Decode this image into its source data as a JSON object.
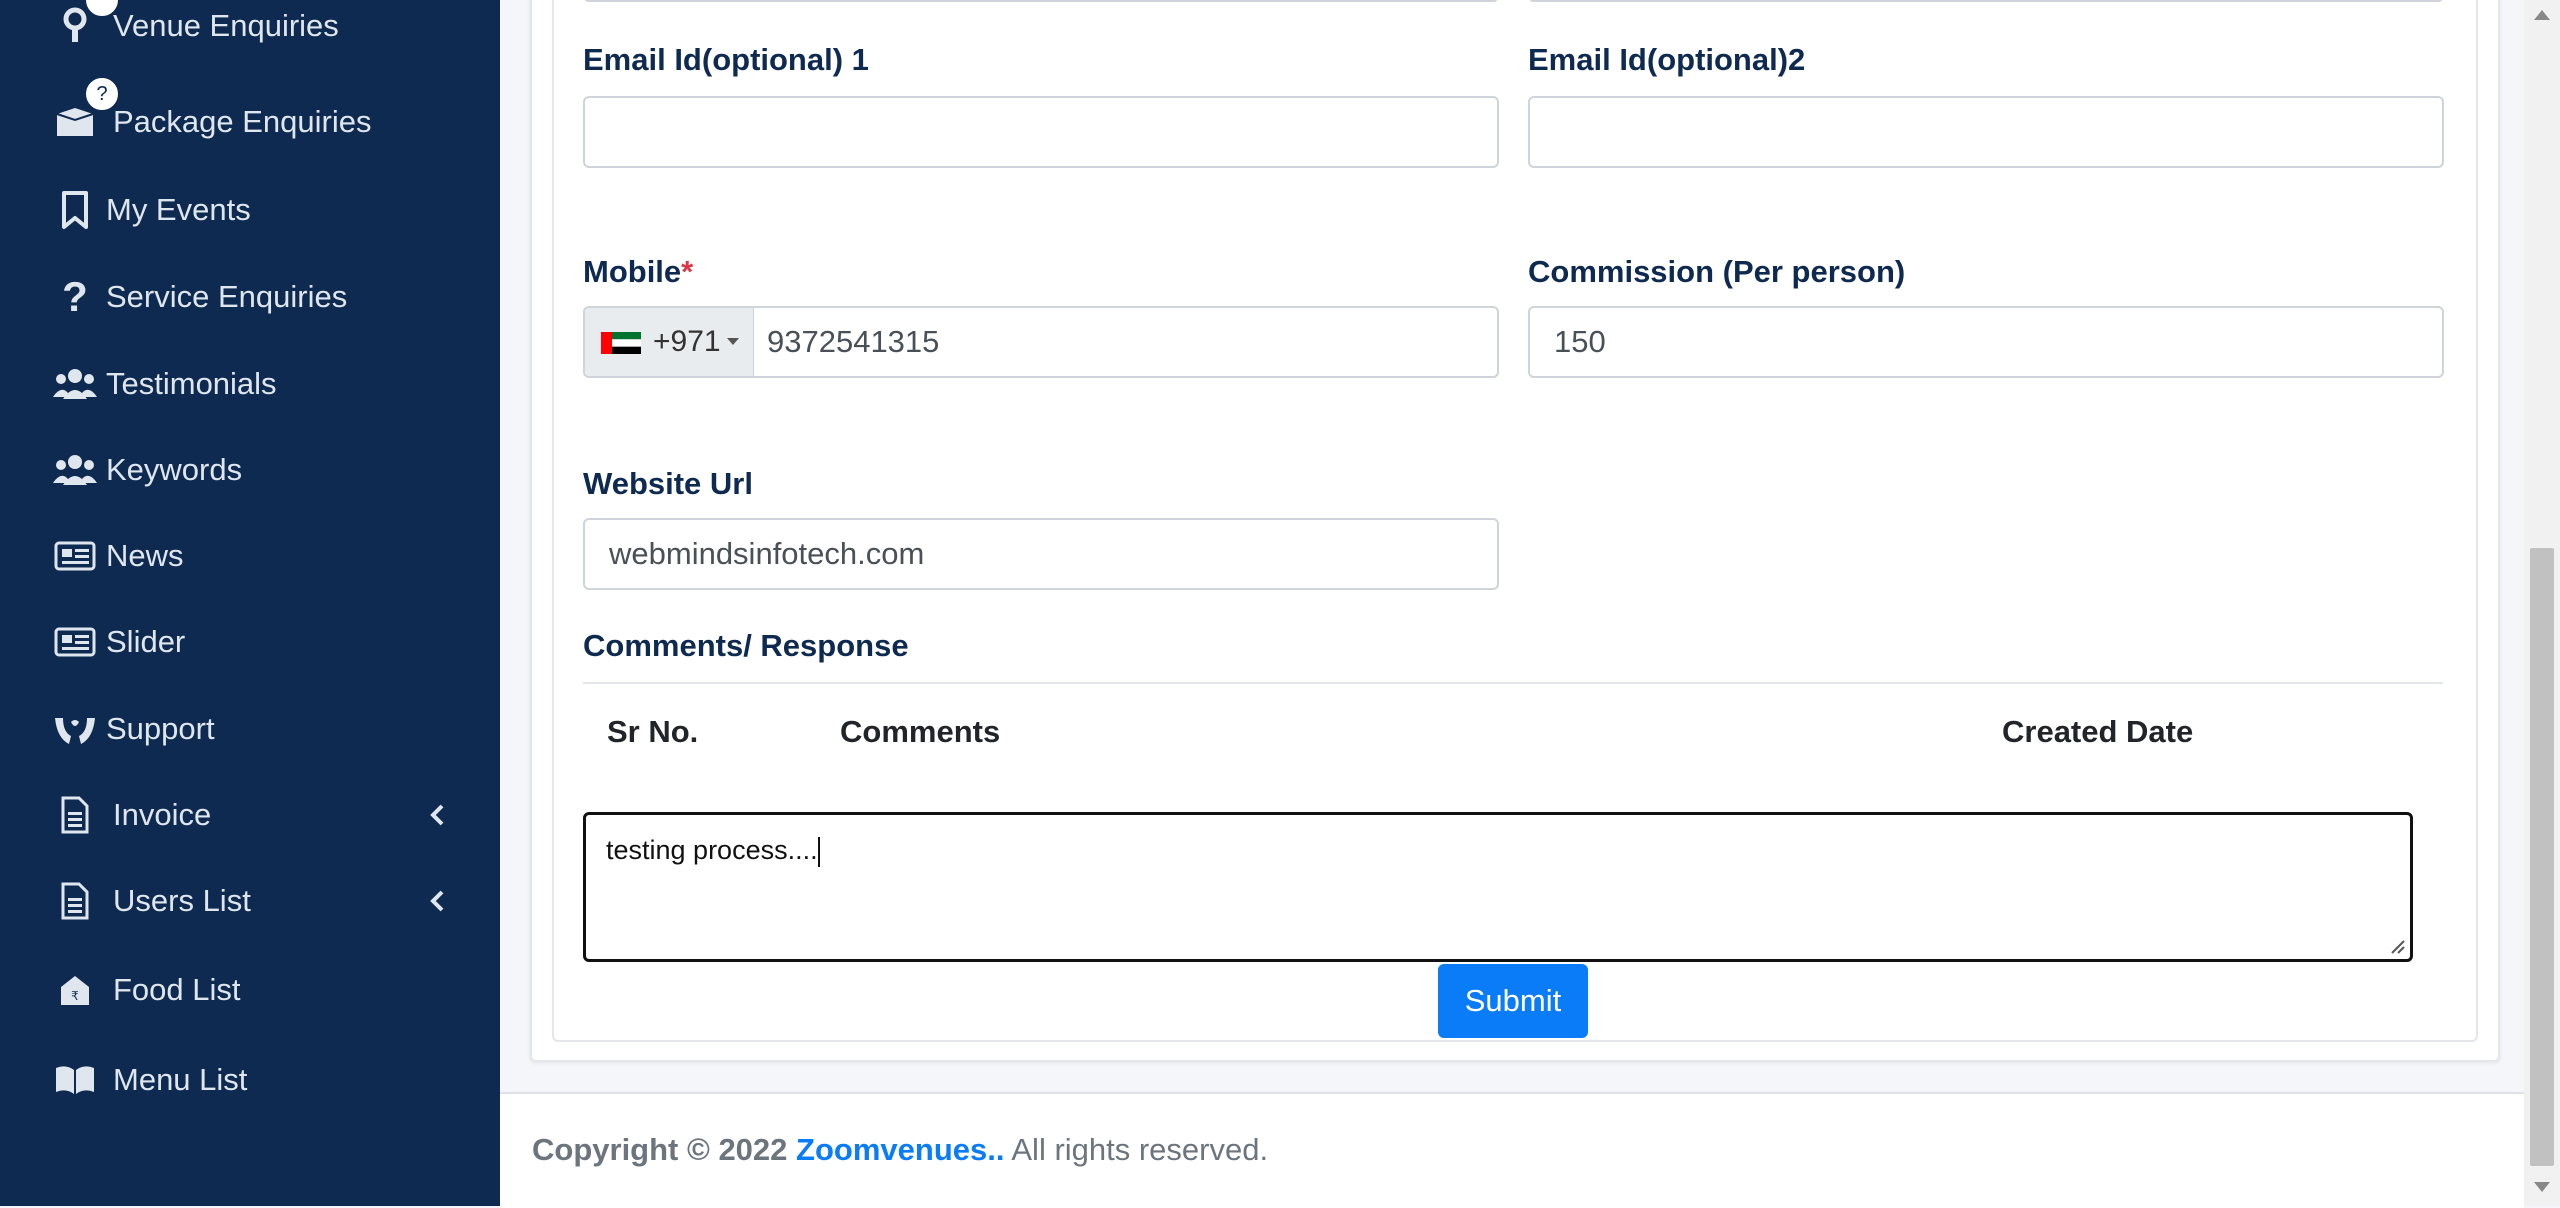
{
  "sidebar": {
    "items": [
      {
        "label": "Venue Enquiries",
        "icon": "venue-pin-icon"
      },
      {
        "label": "Package Enquiries",
        "icon": "package-box-icon",
        "badge": "?"
      },
      {
        "label": "My Events",
        "icon": "bookmark-icon"
      },
      {
        "label": "Service Enquiries",
        "icon": "question-icon"
      },
      {
        "label": "Testimonials",
        "icon": "users-icon"
      },
      {
        "label": "Keywords",
        "icon": "users-icon"
      },
      {
        "label": "News",
        "icon": "newspaper-icon"
      },
      {
        "label": "Slider",
        "icon": "newspaper-icon"
      },
      {
        "label": "Support",
        "icon": "hands-icon"
      },
      {
        "label": "Invoice",
        "icon": "document-icon"
      },
      {
        "label": "Users List",
        "icon": "document-icon"
      },
      {
        "label": "Food List",
        "icon": "store-icon"
      },
      {
        "label": "Menu List",
        "icon": "book-icon"
      }
    ]
  },
  "form": {
    "email1_label": "Email Id(optional) 1",
    "email1_value": "",
    "email2_label": "Email Id(optional)2",
    "email2_value": "",
    "mobile_label": "Mobile",
    "mobile_required": "*",
    "mobile_country_code": "+971",
    "mobile_value": "9372541315",
    "commission_label": "Commission (Per person)",
    "commission_value": "150",
    "website_label": "Website Url",
    "website_value": "webmindsinfotech.com"
  },
  "comments": {
    "section_title": "Comments/ Response",
    "headers": [
      "Sr No.",
      "Comments",
      "Created Date"
    ],
    "textarea_value": "testing process....",
    "submit_label": "Submit"
  },
  "footer": {
    "copyright": "Copyright © 2022",
    "brand": "Zoomvenues..",
    "rights": "All rights reserved."
  },
  "colors": {
    "sidebar_bg": "#0e2a50",
    "accent": "#0a7cf7",
    "required": "#dc3545"
  }
}
